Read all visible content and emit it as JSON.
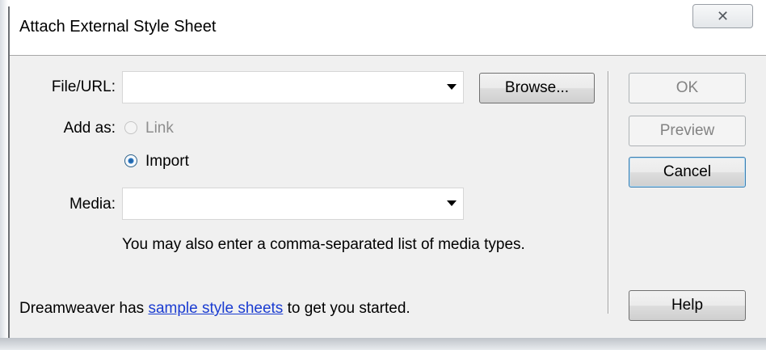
{
  "window": {
    "title": "Attach External Style Sheet",
    "close_glyph": "✕"
  },
  "form": {
    "file_url_label": "File/URL:",
    "file_url_value": "",
    "browse_label": "Browse...",
    "add_as_label": "Add as:",
    "link_option_label": "Link",
    "link_option_enabled": false,
    "import_option_label": "Import",
    "import_option_selected": true,
    "media_label": "Media:",
    "media_value": "",
    "hint_text": "You may also enter a comma-separated list of media types."
  },
  "buttons": {
    "ok_label": "OK",
    "ok_enabled": false,
    "preview_label": "Preview",
    "preview_enabled": false,
    "cancel_label": "Cancel",
    "help_label": "Help"
  },
  "footer": {
    "prefix": "Dreamweaver has ",
    "link_text": "sample style sheets",
    "suffix": " to get you started."
  }
}
